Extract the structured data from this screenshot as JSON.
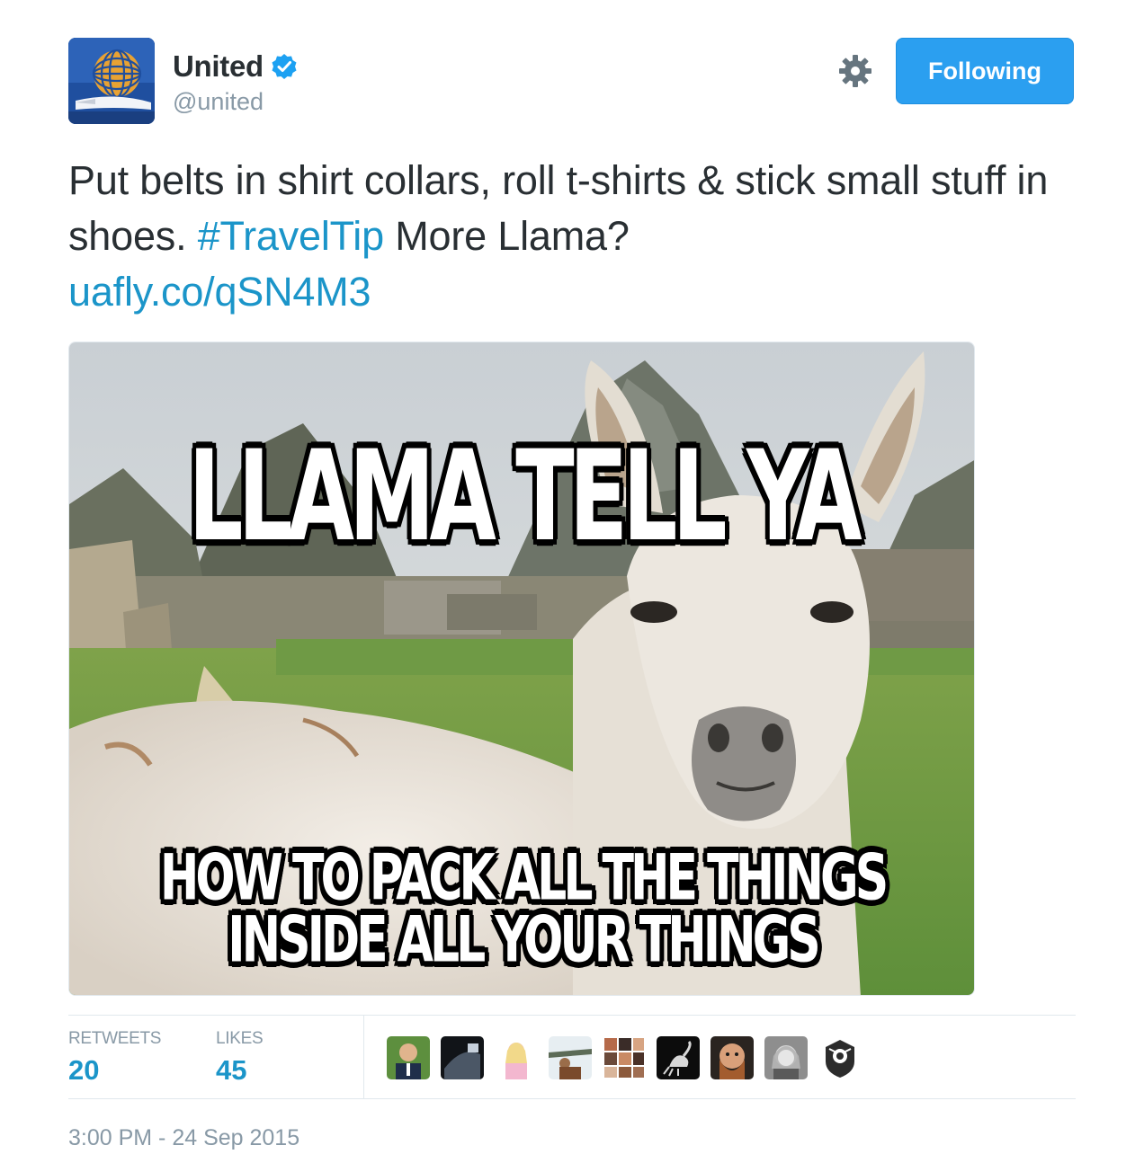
{
  "account": {
    "name": "United",
    "handle": "@united",
    "verified_icon": "verified-badge-icon",
    "avatar_icon": "united-globe-logo"
  },
  "actions": {
    "settings_icon": "gear-icon",
    "follow_label": "Following"
  },
  "tweet": {
    "text_part1": "Put belts in shirt collars, roll t-shirts & stick small stuff in shoes.",
    "hashtag": "#TravelTip",
    "text_part2": "More Llama?",
    "link": "uafly.co/qSN4M3"
  },
  "media": {
    "meme_top": "LLAMA TELL YA",
    "meme_bottom_line1": "HOW TO PACK ALL THE THINGS",
    "meme_bottom_line2": "INSIDE ALL YOUR THINGS"
  },
  "stats": {
    "retweets_label": "RETWEETS",
    "retweets_value": "20",
    "likes_label": "LIKES",
    "likes_value": "45"
  },
  "likers": [
    "avatar-1",
    "avatar-2",
    "avatar-3",
    "avatar-4",
    "avatar-5",
    "avatar-6",
    "avatar-7",
    "avatar-8",
    "avatar-9"
  ],
  "timestamp": "3:00 PM - 24 Sep 2015",
  "colors": {
    "link": "#1b95c9",
    "follow_button": "#2b9ff0",
    "muted": "#8899a6",
    "text": "#292f33"
  }
}
